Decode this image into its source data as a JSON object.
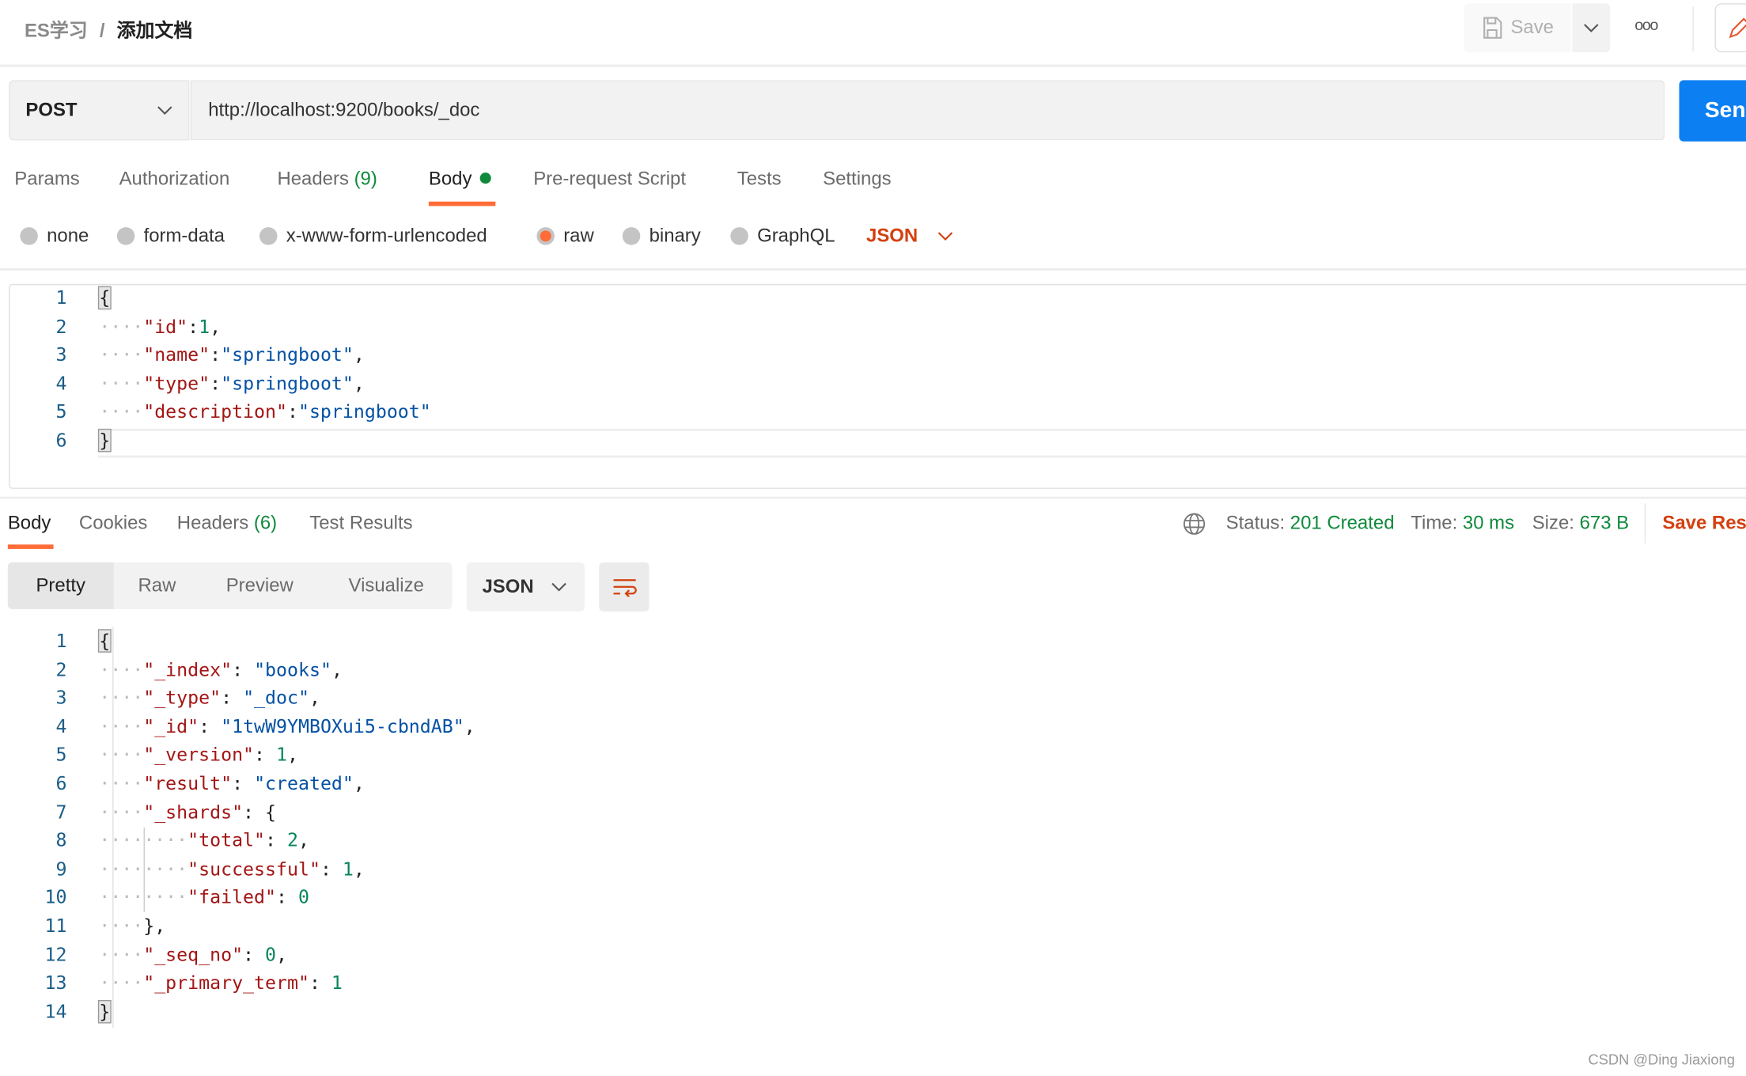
{
  "header": {
    "breadcrumb_parent": "ES学习",
    "separator": "/",
    "breadcrumb_current": "添加文档",
    "save_label": "Save",
    "more_icon": "ooo"
  },
  "request": {
    "method": "POST",
    "url": "http://localhost:9200/books/_doc",
    "send_label": "Send"
  },
  "request_tabs": [
    {
      "label": "Params"
    },
    {
      "label": "Authorization"
    },
    {
      "label": "Headers",
      "count": "(9)"
    },
    {
      "label": "Body"
    },
    {
      "label": "Pre-request Script"
    },
    {
      "label": "Tests"
    },
    {
      "label": "Settings"
    }
  ],
  "body_types": [
    {
      "label": "none"
    },
    {
      "label": "form-data"
    },
    {
      "label": "x-www-form-urlencoded"
    },
    {
      "label": "raw",
      "selected": true
    },
    {
      "label": "binary"
    },
    {
      "label": "GraphQL"
    }
  ],
  "body_format": "JSON",
  "request_body": [
    [
      [
        "pu",
        "{"
      ]
    ],
    [
      [
        "ws",
        "····"
      ],
      [
        "k",
        "\"id\""
      ],
      [
        "pu",
        ":"
      ],
      [
        "n",
        "1"
      ],
      [
        "pu",
        ","
      ]
    ],
    [
      [
        "ws",
        "····"
      ],
      [
        "k",
        "\"name\""
      ],
      [
        "pu",
        ":"
      ],
      [
        "s",
        "\"springboot\""
      ],
      [
        "pu",
        ","
      ]
    ],
    [
      [
        "ws",
        "····"
      ],
      [
        "k",
        "\"type\""
      ],
      [
        "pu",
        ":"
      ],
      [
        "s",
        "\"springboot\""
      ],
      [
        "pu",
        ","
      ]
    ],
    [
      [
        "ws",
        "····"
      ],
      [
        "k",
        "\"description\""
      ],
      [
        "pu",
        ":"
      ],
      [
        "s",
        "\"springboot\""
      ]
    ],
    [
      [
        "pu",
        "}"
      ]
    ]
  ],
  "response_tabs": [
    {
      "label": "Body"
    },
    {
      "label": "Cookies"
    },
    {
      "label": "Headers",
      "count": "(6)"
    },
    {
      "label": "Test Results"
    }
  ],
  "response_status": {
    "status_label": "Status:",
    "status": "201 Created",
    "time_label": "Time:",
    "time": "30 ms",
    "size_label": "Size:",
    "size": "673 B",
    "save_response": "Save Response"
  },
  "view_modes": [
    {
      "label": "Pretty"
    },
    {
      "label": "Raw"
    },
    {
      "label": "Preview"
    },
    {
      "label": "Visualize"
    }
  ],
  "response_format": "JSON",
  "response_body": [
    [
      [
        "pu",
        "{"
      ]
    ],
    [
      [
        "ws",
        "····"
      ],
      [
        "k",
        "\"_index\""
      ],
      [
        "pu",
        ": "
      ],
      [
        "s",
        "\"books\""
      ],
      [
        "pu",
        ","
      ]
    ],
    [
      [
        "ws",
        "····"
      ],
      [
        "k",
        "\"_type\""
      ],
      [
        "pu",
        ": "
      ],
      [
        "s",
        "\"_doc\""
      ],
      [
        "pu",
        ","
      ]
    ],
    [
      [
        "ws",
        "····"
      ],
      [
        "k",
        "\"_id\""
      ],
      [
        "pu",
        ": "
      ],
      [
        "s",
        "\"1twW9YMBOXui5-cbndAB\""
      ],
      [
        "pu",
        ","
      ]
    ],
    [
      [
        "ws",
        "····"
      ],
      [
        "k",
        "\"_version\""
      ],
      [
        "pu",
        ": "
      ],
      [
        "n",
        "1"
      ],
      [
        "pu",
        ","
      ]
    ],
    [
      [
        "ws",
        "····"
      ],
      [
        "k",
        "\"result\""
      ],
      [
        "pu",
        ": "
      ],
      [
        "s",
        "\"created\""
      ],
      [
        "pu",
        ","
      ]
    ],
    [
      [
        "ws",
        "····"
      ],
      [
        "k",
        "\"_shards\""
      ],
      [
        "pu",
        ": {"
      ]
    ],
    [
      [
        "ws",
        "········"
      ],
      [
        "k",
        "\"total\""
      ],
      [
        "pu",
        ": "
      ],
      [
        "n",
        "2"
      ],
      [
        "pu",
        ","
      ]
    ],
    [
      [
        "ws",
        "········"
      ],
      [
        "k",
        "\"successful\""
      ],
      [
        "pu",
        ": "
      ],
      [
        "n",
        "1"
      ],
      [
        "pu",
        ","
      ]
    ],
    [
      [
        "ws",
        "········"
      ],
      [
        "k",
        "\"failed\""
      ],
      [
        "pu",
        ": "
      ],
      [
        "n",
        "0"
      ]
    ],
    [
      [
        "ws",
        "····"
      ],
      [
        "pu",
        "},"
      ]
    ],
    [
      [
        "ws",
        "····"
      ],
      [
        "k",
        "\"_seq_no\""
      ],
      [
        "pu",
        ": "
      ],
      [
        "n",
        "0"
      ],
      [
        "pu",
        ","
      ]
    ],
    [
      [
        "ws",
        "····"
      ],
      [
        "k",
        "\"_primary_term\""
      ],
      [
        "pu",
        ": "
      ],
      [
        "n",
        "1"
      ]
    ],
    [
      [
        "pu",
        "}"
      ]
    ]
  ],
  "watermark": "CSDN @Ding Jiaxiong",
  "colors": {
    "accent": "#ff6c37",
    "send": "#0c7ff2",
    "success": "#0f8a3c",
    "save_response": "#d3400f"
  }
}
